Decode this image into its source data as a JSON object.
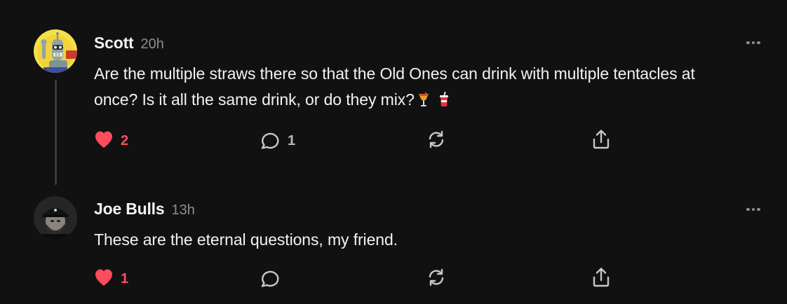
{
  "comments": [
    {
      "author": "Scott",
      "time": "20h",
      "avatar": "bender-robot-avatar",
      "text": "Are the multiple straws there so that the Old Ones can drink with multiple tentacles at once? Is it all the same drink, or do they mix?",
      "emojis": [
        "tropical-drink-icon",
        "cup-with-straw-icon"
      ],
      "likes": "2",
      "liked": true,
      "replies": "1"
    },
    {
      "author": "Joe Bulls",
      "time": "13h",
      "avatar": "bearded-man-avatar",
      "text": "These are the eternal questions, my friend.",
      "likes": "1",
      "liked": true,
      "replies": ""
    }
  ],
  "icons": {
    "like": "heart-icon",
    "comment": "speech-bubble-icon",
    "restack": "restack-icon",
    "share": "share-icon",
    "more": "more-options-icon"
  },
  "colors": {
    "background": "#111112",
    "liked": "#ff4d5e",
    "muted": "#8e8e93",
    "text": "#f2f2f2"
  }
}
